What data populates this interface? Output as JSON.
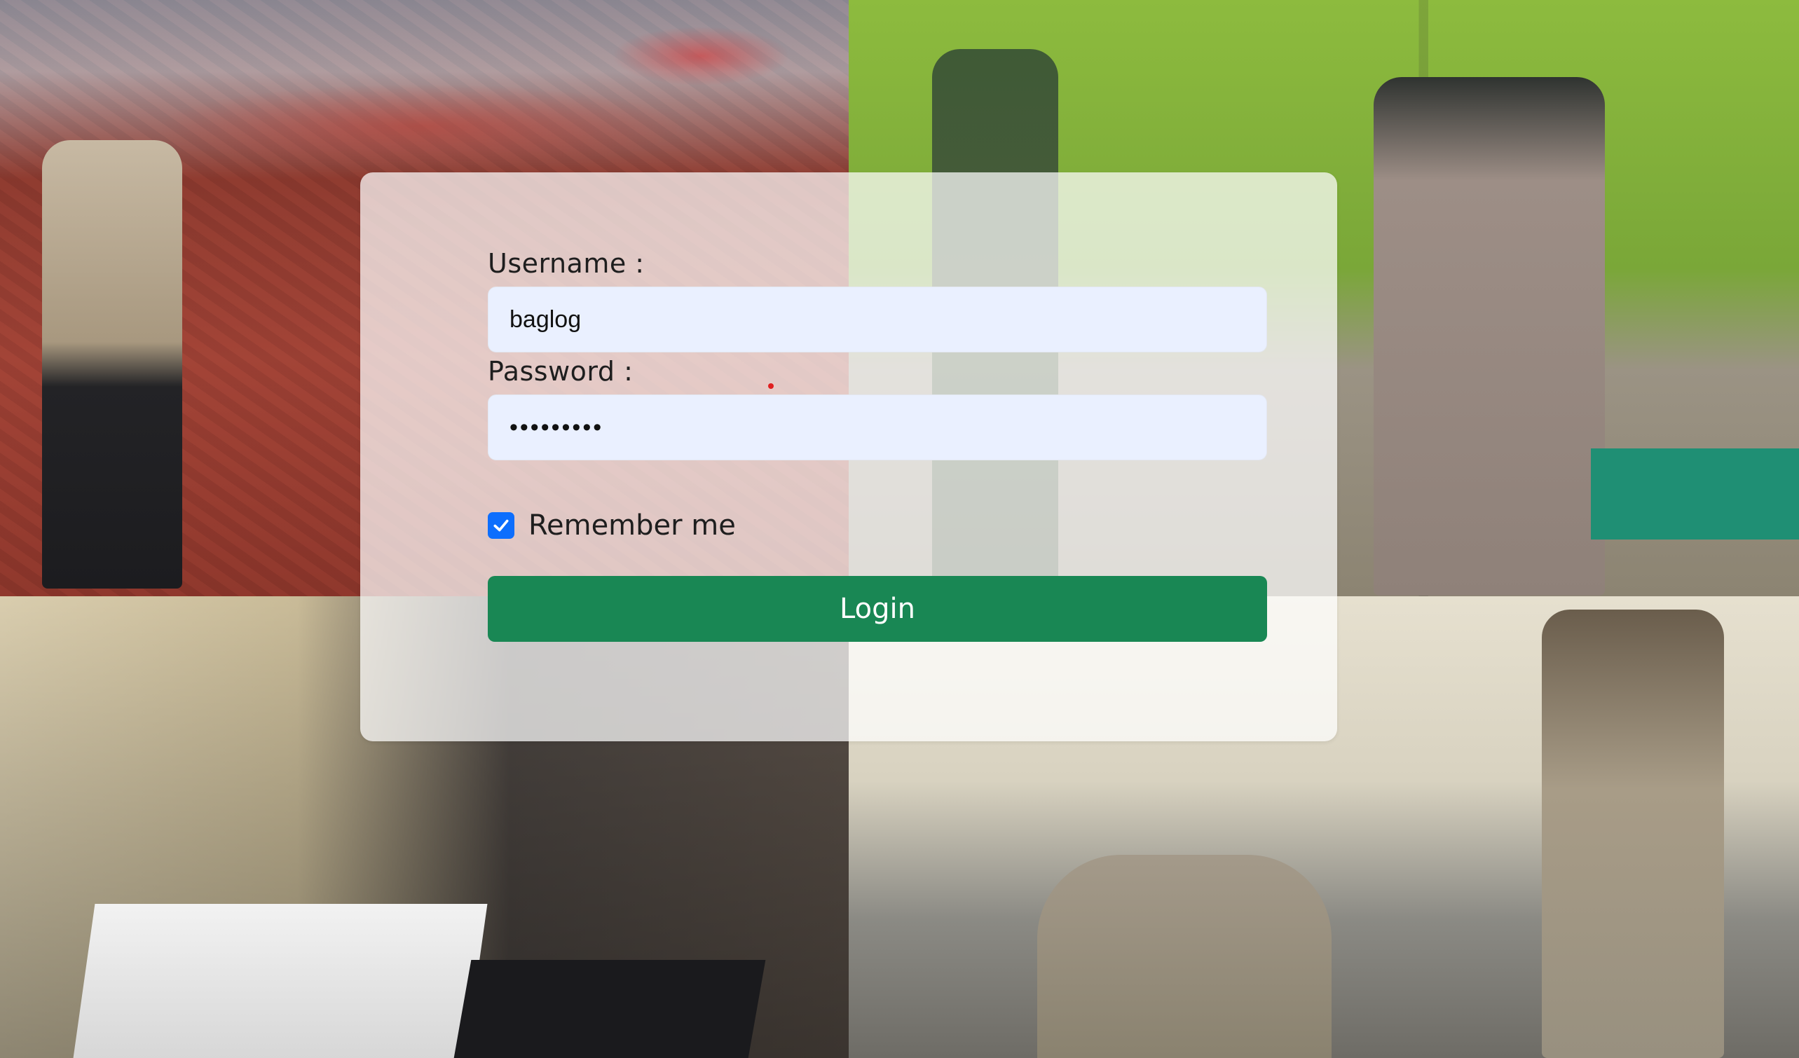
{
  "background": {
    "tiles": [
      "photo-police-boat-inspection",
      "photo-shooting-range",
      "photo-office-desk",
      "photo-police-meeting-hall"
    ]
  },
  "login_form": {
    "username_label": "Username :",
    "username_value": "baglog",
    "password_label": "Password :",
    "password_value": "•••••••••",
    "remember_label": "Remember me",
    "remember_checked": true,
    "login_button": "Login"
  },
  "colors": {
    "login_button": "#198754",
    "checkbox": "#0d6efd",
    "input_background": "#eaf0ff"
  }
}
